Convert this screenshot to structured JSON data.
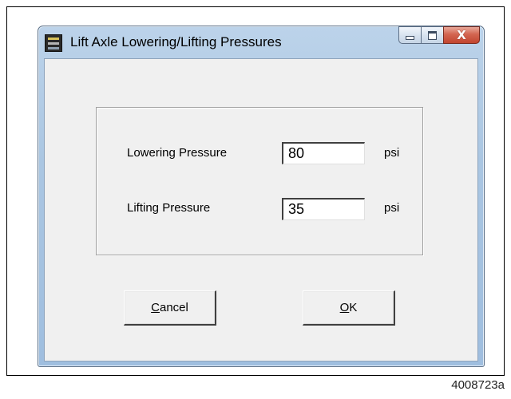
{
  "window": {
    "title": "Lift Axle Lowering/Lifting Pressures",
    "icon": "app-icon",
    "caption_icons": [
      "minimize-icon",
      "maximize-icon",
      "close-icon"
    ],
    "close_glyph": "X"
  },
  "form": {
    "lowering": {
      "label": "Lowering Pressure",
      "value": "80",
      "unit": "psi"
    },
    "lifting": {
      "label": "Lifting Pressure",
      "value": "35",
      "unit": "psi"
    }
  },
  "buttons": {
    "cancel": {
      "accel": "C",
      "rest": "ancel"
    },
    "ok": {
      "accel": "O",
      "rest": "K"
    }
  },
  "figure_id": "4008723a",
  "colors": {
    "close_button": "#c2452f",
    "dialog_face": "#f0f0f0",
    "frame": "#aac6e2"
  }
}
